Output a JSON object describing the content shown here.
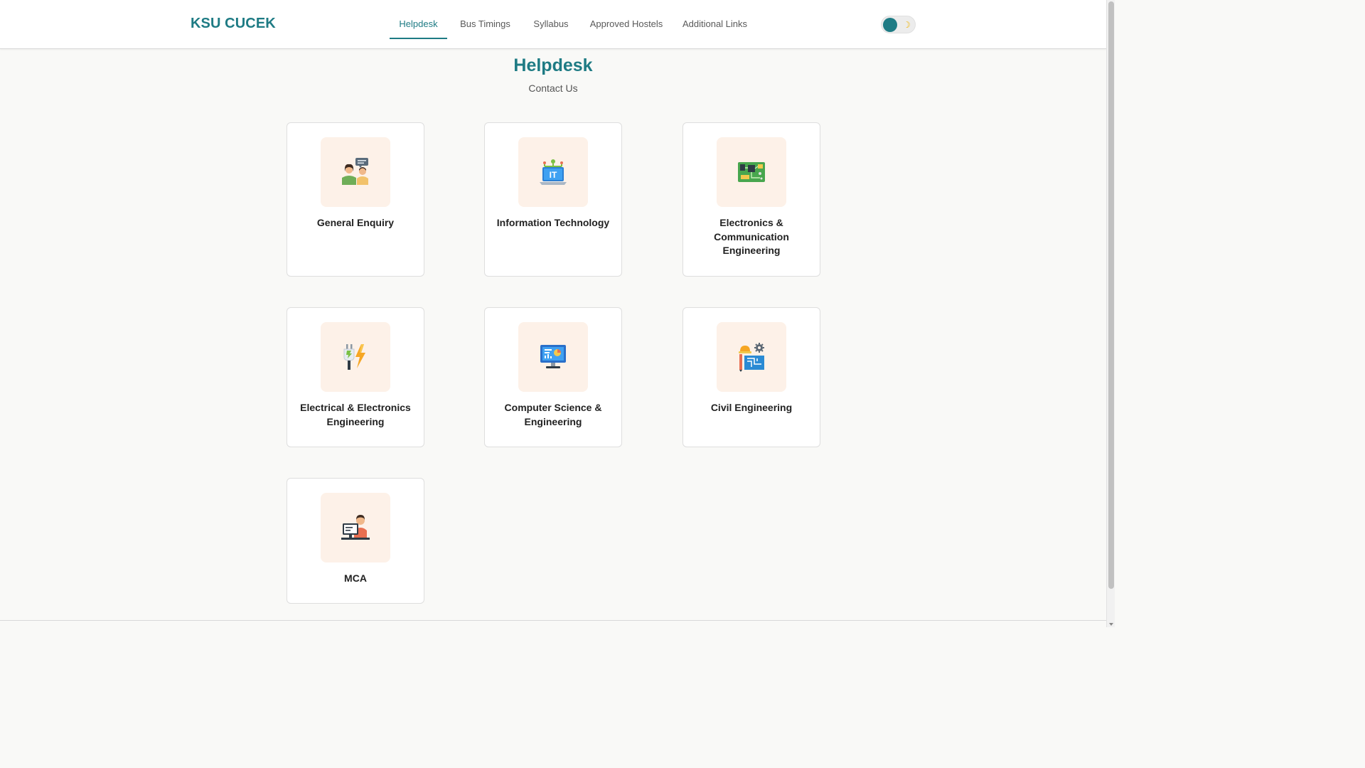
{
  "header": {
    "brand": "KSU CUCEK",
    "nav": [
      {
        "label": "Helpdesk",
        "active": true
      },
      {
        "label": "Bus Timings",
        "active": false
      },
      {
        "label": "Syllabus",
        "active": false
      },
      {
        "label": "Approved Hostels",
        "active": false
      },
      {
        "label": "Additional Links",
        "active": false
      }
    ],
    "theme_toggle": {
      "icon": "moon-icon",
      "state": "light"
    }
  },
  "page": {
    "title": "Helpdesk",
    "subtitle": "Contact Us"
  },
  "cards": [
    {
      "label": "General Enquiry",
      "icon": "help-desk-icon"
    },
    {
      "label": "Information Technology",
      "icon": "it-laptop-icon"
    },
    {
      "label": "Electronics & Communication Engineering",
      "icon": "circuit-board-icon"
    },
    {
      "label": "Electrical & Electronics Engineering",
      "icon": "plug-lightning-icon"
    },
    {
      "label": "Computer Science & Engineering",
      "icon": "computer-monitor-icon"
    },
    {
      "label": "Civil Engineering",
      "icon": "blueprint-helmet-icon"
    },
    {
      "label": "MCA",
      "icon": "person-computer-icon"
    }
  ],
  "colors": {
    "accent": "#1e7b84",
    "icon_tile": "#fdf1e8",
    "background": "#f9f9f7"
  }
}
